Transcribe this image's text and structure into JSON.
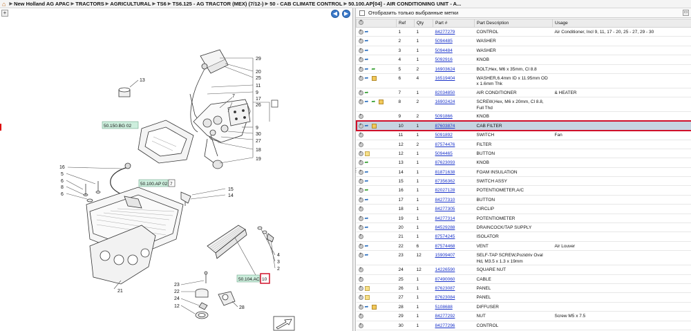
{
  "breadcrumb": [
    "New Holland AG APAC",
    "TRACTORS",
    "AGRICULTURAL",
    "TS6",
    "TS6.125 - AG TRACTOR (MEX) (7/12-)",
    "50 - CAB CLIMATE CONTROL",
    "50.100.AP[04] - AIR CONDITIONING UNIT - A..."
  ],
  "right_toolbar": {
    "show_selected_label": "Отобразить только выбранные метки"
  },
  "table": {
    "headers": {
      "ref": "Ref",
      "qty": "Qty",
      "part": "Part #",
      "desc": "Part Description",
      "usage": "Usage"
    },
    "rows": [
      {
        "icons": [
          "add",
          "blue"
        ],
        "ref": "1",
        "qty": "1",
        "part": "84277279",
        "desc": "CONTROL",
        "usage": "Air Conditioner, Incl 9, 11, 17 - 20, 25 - 27, 29 - 30"
      },
      {
        "icons": [
          "add",
          "blue"
        ],
        "ref": "2",
        "qty": "1",
        "part": "5094485",
        "desc": "WASHER",
        "usage": ""
      },
      {
        "icons": [
          "add",
          "blue"
        ],
        "ref": "3",
        "qty": "1",
        "part": "5094484",
        "desc": "WASHER",
        "usage": ""
      },
      {
        "icons": [
          "add",
          "blue"
        ],
        "ref": "4",
        "qty": "1",
        "part": "5092916",
        "desc": "KNOB",
        "usage": ""
      },
      {
        "icons": [
          "add",
          "blue",
          "green"
        ],
        "ref": "5",
        "qty": "2",
        "part": "16903624",
        "desc": "BOLT,Hex, M6 x 35mm, Cl 8.8",
        "usage": ""
      },
      {
        "icons": [
          "add",
          "blue",
          "box"
        ],
        "ref": "6",
        "qty": "4",
        "part": "16519404",
        "desc": "WASHER,6.4mm ID x 11.95mm OD x 1.6mm Thk",
        "usage": "",
        "tall": true
      },
      {
        "icons": [
          "add",
          "green"
        ],
        "ref": "7",
        "qty": "1",
        "part": "82034850",
        "desc": "AIR CONDITIONER",
        "usage": "& HEATER"
      },
      {
        "icons": [
          "add",
          "blue",
          "green",
          "box"
        ],
        "ref": "8",
        "qty": "2",
        "part": "16902424",
        "desc": "SCREW,Hex, M6 x 20mm, Cl 8.8, Full Thd",
        "usage": ""
      },
      {
        "icons": [
          "add"
        ],
        "ref": "9",
        "qty": "2",
        "part": "5091866",
        "desc": "KNOB",
        "usage": ""
      },
      {
        "icons": [
          "add",
          "blue",
          "box"
        ],
        "ref": "10",
        "qty": "1",
        "part": "87603874",
        "desc": "CAB FILTER",
        "usage": "",
        "selected": true
      },
      {
        "icons": [
          "add"
        ],
        "ref": "11",
        "qty": "1",
        "part": "5091892",
        "desc": "SWITCH",
        "usage": "Fan"
      },
      {
        "icons": [
          "add"
        ],
        "ref": "12",
        "qty": "2",
        "part": "87574476",
        "desc": "FILTER",
        "usage": ""
      },
      {
        "icons": [
          "add",
          "note"
        ],
        "ref": "12",
        "qty": "1",
        "part": "5094465",
        "desc": "BUTTON",
        "usage": ""
      },
      {
        "icons": [
          "add",
          "green"
        ],
        "ref": "13",
        "qty": "1",
        "part": "87623093",
        "desc": "KNOB",
        "usage": ""
      },
      {
        "icons": [
          "add",
          "blue"
        ],
        "ref": "14",
        "qty": "1",
        "part": "81871638",
        "desc": "FOAM INSULATION",
        "usage": ""
      },
      {
        "icons": [
          "add",
          "blue"
        ],
        "ref": "15",
        "qty": "1",
        "part": "87356362",
        "desc": "SWITCH ASSY",
        "usage": ""
      },
      {
        "icons": [
          "add",
          "green"
        ],
        "ref": "16",
        "qty": "1",
        "part": "82027128",
        "desc": "POTENTIOMETER,A/C",
        "usage": ""
      },
      {
        "icons": [
          "add",
          "blue"
        ],
        "ref": "17",
        "qty": "1",
        "part": "84277310",
        "desc": "BUTTON",
        "usage": ""
      },
      {
        "icons": [
          "add"
        ],
        "ref": "18",
        "qty": "1",
        "part": "84277305",
        "desc": "CIRCLIP",
        "usage": ""
      },
      {
        "icons": [
          "add",
          "blue"
        ],
        "ref": "19",
        "qty": "1",
        "part": "84277314",
        "desc": "POTENTIOMETER",
        "usage": ""
      },
      {
        "icons": [
          "add",
          "blue"
        ],
        "ref": "20",
        "qty": "1",
        "part": "84529288",
        "desc": "DRAINCOCK/TAP SUPPLY",
        "usage": ""
      },
      {
        "icons": [
          "add"
        ],
        "ref": "21",
        "qty": "1",
        "part": "87574245",
        "desc": "ISOLATOR",
        "usage": ""
      },
      {
        "icons": [
          "add",
          "blue"
        ],
        "ref": "22",
        "qty": "6",
        "part": "87574468",
        "desc": "VENT",
        "usage": "Air Louver"
      },
      {
        "icons": [
          "add",
          "blue"
        ],
        "ref": "23",
        "qty": "12",
        "part": "15909407",
        "desc": "SELF-TAP SCREW,Pozidriv Oval Hd, M3.5 x 1.3 x 19mm",
        "usage": "",
        "tall": true
      },
      {
        "icons": [
          "add"
        ],
        "ref": "24",
        "qty": "12",
        "part": "14226590",
        "desc": "SQUARE NUT",
        "usage": ""
      },
      {
        "icons": [
          "add"
        ],
        "ref": "25",
        "qty": "1",
        "part": "87490060",
        "desc": "CABLE",
        "usage": ""
      },
      {
        "icons": [
          "add",
          "note"
        ],
        "ref": "26",
        "qty": "1",
        "part": "87623087",
        "desc": "PANEL",
        "usage": ""
      },
      {
        "icons": [
          "add",
          "note"
        ],
        "ref": "27",
        "qty": "1",
        "part": "87623084",
        "desc": "PANEL",
        "usage": ""
      },
      {
        "icons": [
          "add",
          "blue",
          "box"
        ],
        "ref": "28",
        "qty": "1",
        "part": "5108688",
        "desc": "DIFFUSER",
        "usage": ""
      },
      {
        "icons": [
          "add"
        ],
        "ref": "29",
        "qty": "1",
        "part": "84277292",
        "desc": "NUT",
        "usage": "Screw M5 x 7.5"
      },
      {
        "icons": [
          "add"
        ],
        "ref": "30",
        "qty": "1",
        "part": "84277296",
        "desc": "CONTROL",
        "usage": ""
      }
    ]
  },
  "diagram": {
    "callouts": {
      "c13": "13",
      "c29": "29",
      "c20": "20",
      "c25": "25",
      "c11": "11",
      "c9a": "9",
      "c17": "17",
      "c26": "26",
      "c1": "1",
      "c7": "7",
      "c9b": "9",
      "c30": "30",
      "c27": "27",
      "c18": "18",
      "c19": "19",
      "c16": "16",
      "c5": "5",
      "c6": "6",
      "c8": "8",
      "c15": "15",
      "c14": "14",
      "c4": "4",
      "c3": "3",
      "c2": "2",
      "c21": "21",
      "c23": "23",
      "c22": "22",
      "c24": "24",
      "c12": "12",
      "c28": "28"
    },
    "refs": {
      "bg02": "50.150.BG 02",
      "ap02": "50.100.AP 02",
      "ap02_count": "7",
      "ac": "50.104.AC",
      "ac_count": "10"
    }
  },
  "colors": {
    "selected_row": "#c7d4e1",
    "highlight": "#d0102a",
    "link": "#1a33c9",
    "ref_tag": "#cdeedd"
  }
}
